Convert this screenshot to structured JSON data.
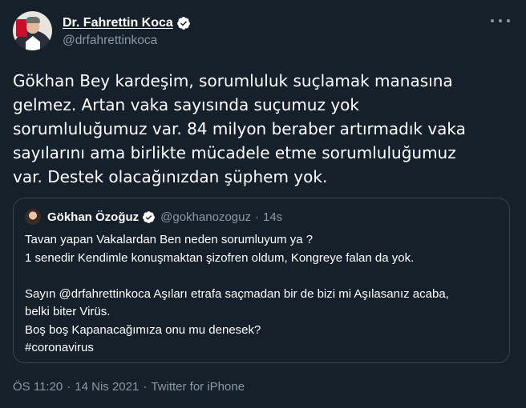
{
  "author": {
    "display_name": "Dr. Fahrettin Koca",
    "handle": "@drfahrettinkoca",
    "avatar_icon": "profile-photo",
    "verified_icon": "verified-badge-icon"
  },
  "more_icon": "more-options-icon",
  "tweet_text": "Gökhan Bey kardeşim, sorumluluk suçlamak manasına\ngelmez. Artan vaka sayısında suçumuz yok\nsorumluluğumuz var. 84 milyon beraber artırmadık vaka\nsayılarını ama birlikte mücadele etme sorumluluğumuz\nvar. Destek olacağınızdan şüphem yok.",
  "quoted_tweet": {
    "display_name": "Gökhan Özoğuz",
    "handle": "@gokhanozoguz",
    "separator": "·",
    "time": "14s",
    "text": "Tavan yapan Vakalardan Ben neden sorumluyum ya ?\n1 senedir Kendimle konuşmaktan şizofren oldum, Kongreye falan da yok.\n\nSayın @drfahrettinkoca Aşıları etrafa saçmadan bir de bizi mi Aşılasanız acaba,\nbelki biter Virüs.\nBoş boş Kapanacağımıza onu mu denesek?\n#coronavirus"
  },
  "meta": {
    "time": "ÖS 11:20",
    "separator1": "·",
    "date": "14 Nis 2021",
    "separator2": "·",
    "source": "Twitter for iPhone"
  },
  "colors": {
    "background": "#15202b",
    "verified_blue": "#1da1f2",
    "secondary_text": "#8899a6",
    "border": "#38444d"
  }
}
